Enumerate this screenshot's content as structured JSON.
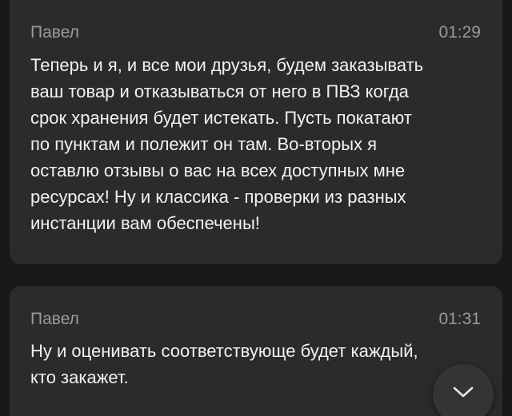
{
  "messages": [
    {
      "author": "Павел",
      "time": "01:29",
      "text": "Теперь и я, и все мои друзья, будем заказывать\nваш товар и отказываться от него в ПВЗ когда\nсрок хранения будет истекать. Пусть покатают\nпо пунктам и полежит он там. Во-вторых я\nоставлю отзывы о вас на всех доступных мне\nресурсах! Ну и классика - проверки из разных\nинстанции вам обеспечены!"
    },
    {
      "author": "Павел",
      "time": "01:31",
      "text": "Ну и оценивать соответствующе будет каждый,\nкто закажет."
    }
  ],
  "scroll_button": {
    "icon": "chevron-down-icon"
  },
  "colors": {
    "background": "#181818",
    "bubble": "#2b2b2b",
    "meta_text": "#9a9a9a",
    "message_text": "#f2f2f2"
  }
}
